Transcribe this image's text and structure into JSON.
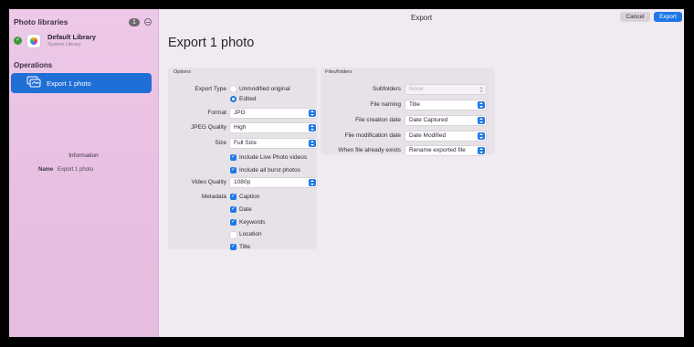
{
  "sidebar": {
    "header": "Photo libraries",
    "badge": "1",
    "library": {
      "name": "Default Library",
      "subtitle": "System Library"
    },
    "operations_header": "Operations",
    "operation": "Export 1 photo",
    "info_title": "Information",
    "info_key": "Name",
    "info_value": "Export 1 photo"
  },
  "toolbar": {
    "title": "Export",
    "cancel": "Cancel",
    "export": "Export"
  },
  "page_title": "Export 1 photo",
  "options": {
    "title": "Options",
    "export_type_label": "Export Type",
    "export_type_options": [
      "Unmodified original",
      "Edited"
    ],
    "export_type_selected": "Edited",
    "format_label": "Format",
    "format_value": "JPG",
    "jpeg_quality_label": "JPEG Quality",
    "jpeg_quality_value": "High",
    "size_label": "Size",
    "size_value": "Full Size",
    "include_live": "Include Live Photo videos",
    "include_burst": "Include all burst photos",
    "video_quality_label": "Video Quality",
    "video_quality_value": "1080p",
    "metadata_label": "Metadata",
    "metadata": [
      {
        "label": "Caption",
        "checked": true
      },
      {
        "label": "Date",
        "checked": true
      },
      {
        "label": "Keywords",
        "checked": true
      },
      {
        "label": "Location",
        "checked": false
      },
      {
        "label": "Title",
        "checked": true
      }
    ]
  },
  "files": {
    "title": "Files/folders",
    "subfolders_label": "Subfolders",
    "subfolders_value": "None",
    "naming_label": "File naming",
    "naming_value": "Title",
    "creation_label": "File creation date",
    "creation_value": "Date Captured",
    "modification_label": "File modification date",
    "modification_value": "Date Modified",
    "exists_label": "When file already exists",
    "exists_value": "Rename exported file"
  },
  "colors": {
    "accent": "#1f78e6",
    "sidebar": "#eec9e7",
    "selected": "#1f6fd6"
  },
  "icons": [
    "checkmark-circle-icon",
    "photos-library-icon",
    "export-photo-icon",
    "remove-circle-icon",
    "popup-arrows-icon",
    "checkbox-icon"
  ]
}
